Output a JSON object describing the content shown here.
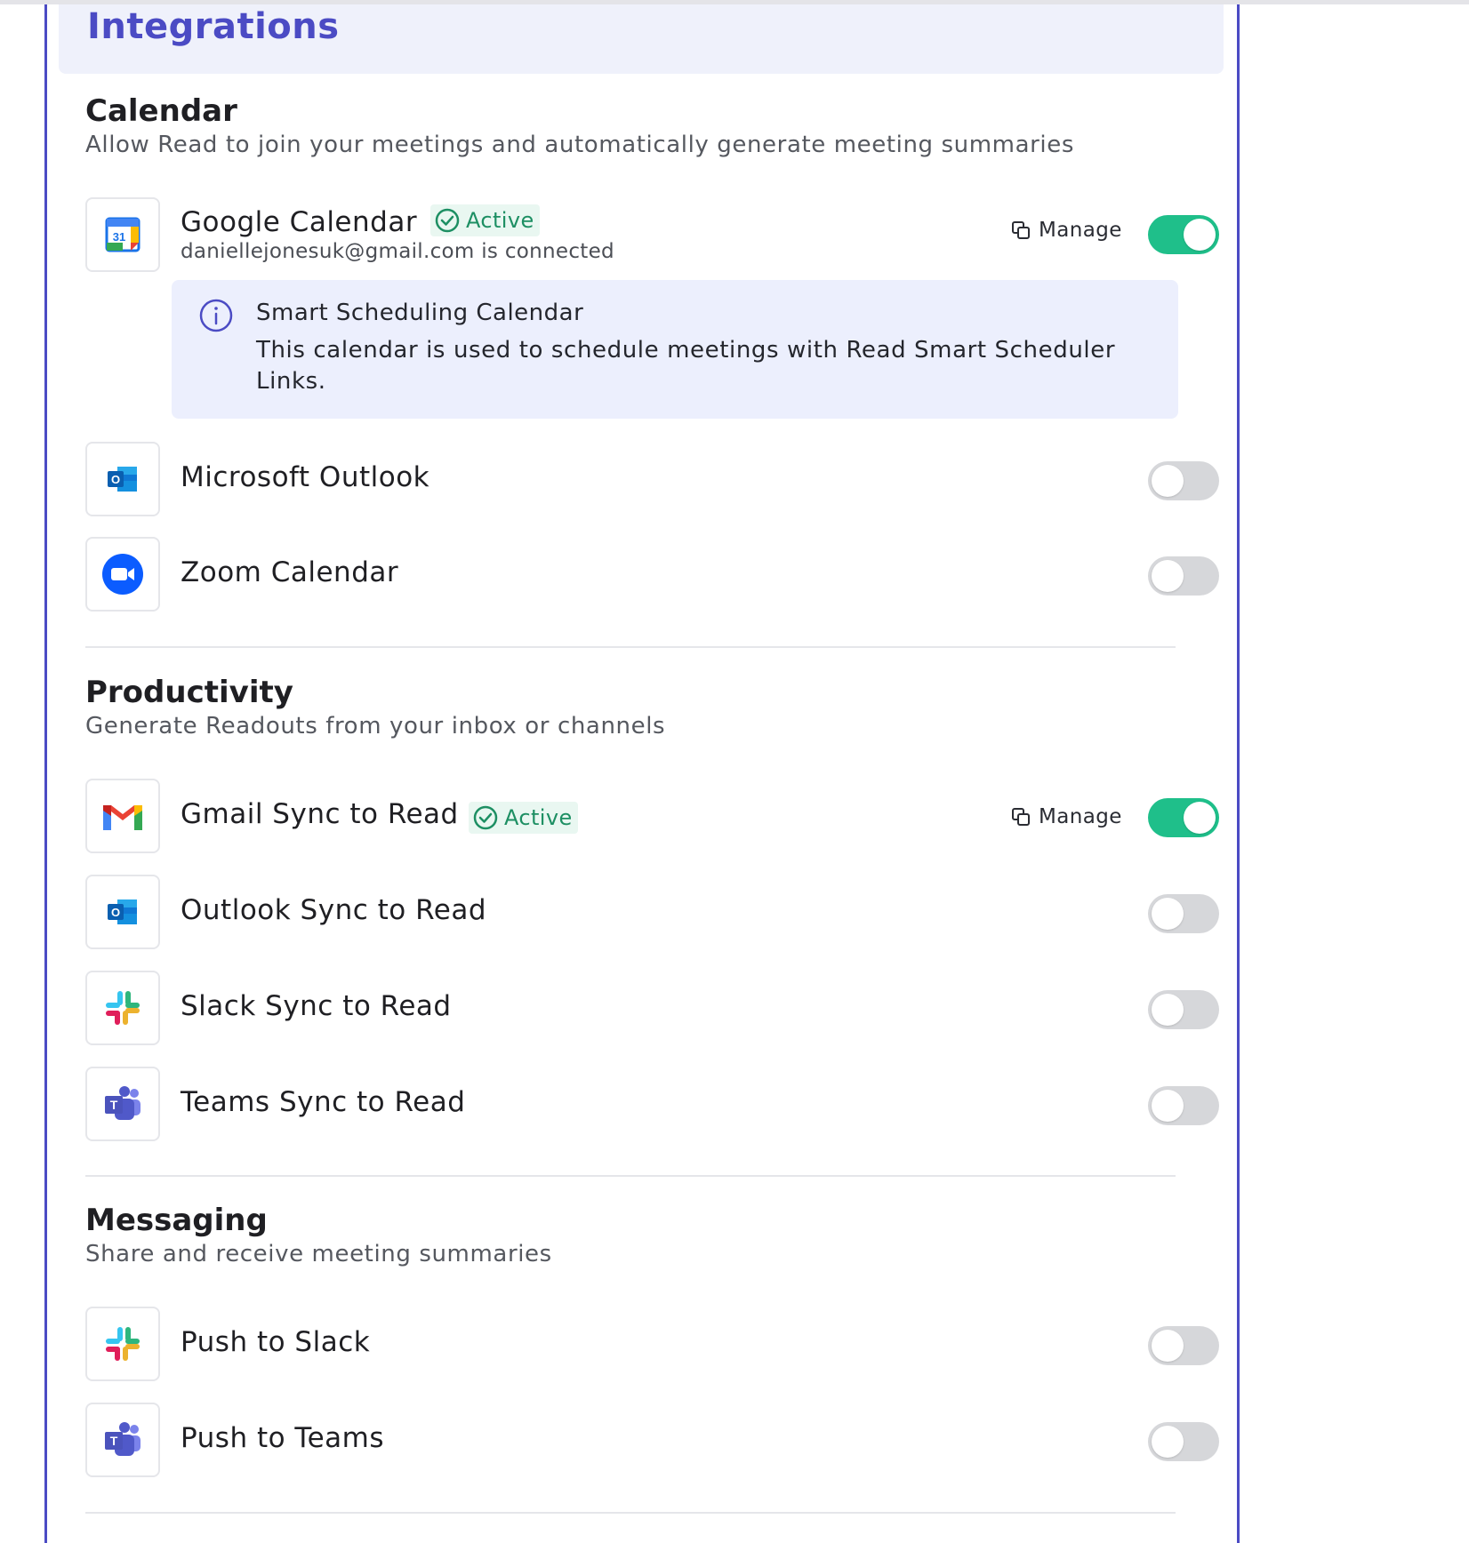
{
  "header": {
    "title": "Integrations"
  },
  "sections": {
    "calendar": {
      "title": "Calendar",
      "description": "Allow Read to join your meetings and automatically generate meeting summaries",
      "google": {
        "name": "Google Calendar",
        "status": "Active",
        "sub": "daniellejonesuk@gmail.com is connected",
        "manage_label": "Manage",
        "enabled": true,
        "info_title": "Smart Scheduling Calendar",
        "info_text": "This calendar is used to schedule meetings with Read Smart Scheduler Links."
      },
      "outlook": {
        "name": "Microsoft Outlook",
        "enabled": false
      },
      "zoom": {
        "name": "Zoom Calendar",
        "enabled": false
      }
    },
    "productivity": {
      "title": "Productivity",
      "description": "Generate Readouts from your inbox or channels",
      "gmail": {
        "name": "Gmail Sync to Read",
        "status": "Active",
        "manage_label": "Manage",
        "enabled": true
      },
      "outlook": {
        "name": "Outlook Sync to Read",
        "enabled": false
      },
      "slack": {
        "name": "Slack Sync to Read",
        "enabled": false
      },
      "teams": {
        "name": "Teams Sync to Read",
        "enabled": false
      }
    },
    "messaging": {
      "title": "Messaging",
      "description": "Share and receive meeting summaries",
      "slack": {
        "name": "Push to Slack",
        "enabled": false
      },
      "teams": {
        "name": "Push to Teams",
        "enabled": false
      }
    }
  },
  "icons": {
    "google_calendar_day": "31",
    "outlook_letter": "O",
    "teams_letter": "T"
  },
  "colors": {
    "accent": "#4b4bc4",
    "toggle_on": "#1fbf8a",
    "active_green": "#1d8f63"
  }
}
